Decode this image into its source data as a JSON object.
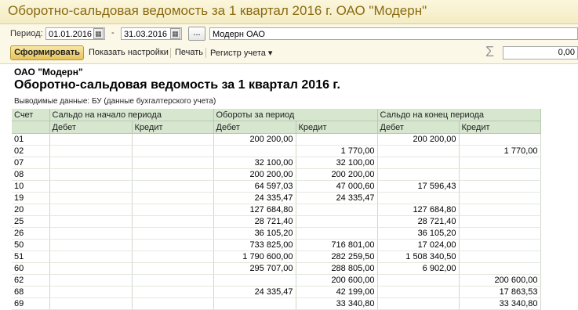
{
  "window": {
    "title": "Оборотно-сальдовая ведомость за 1 квартал 2016 г. ОАО \"Модерн\""
  },
  "period": {
    "label": "Период:",
    "from": "01.01.2016",
    "separator": "-",
    "to": "31.03.2016",
    "dots": "...",
    "organization": "Модерн ОАО"
  },
  "toolbar": {
    "generate": "Сформировать",
    "show_settings": "Показать настройки",
    "print": "Печать",
    "register": "Регистр учета ▾",
    "sigma": "Σ",
    "sum": "0,00"
  },
  "report": {
    "organization": "ОАО \"Модерн\"",
    "title": "Оборотно-сальдовая ведомость за 1 квартал 2016 г.",
    "subtitle": "Выводимые данные:  БУ (данные бухгалтерского учета)",
    "headers": {
      "account": "Счет",
      "opening": "Сальдо на начало периода",
      "turnover": "Обороты за период",
      "closing": "Сальдо на конец периода",
      "debit": "Дебет",
      "credit": "Кредит"
    },
    "rows": [
      [
        "01",
        "",
        "",
        "200 200,00",
        "",
        "200 200,00",
        ""
      ],
      [
        "02",
        "",
        "",
        "",
        "1 770,00",
        "",
        "1 770,00"
      ],
      [
        "07",
        "",
        "",
        "32 100,00",
        "32 100,00",
        "",
        ""
      ],
      [
        "08",
        "",
        "",
        "200 200,00",
        "200 200,00",
        "",
        ""
      ],
      [
        "10",
        "",
        "",
        "64 597,03",
        "47 000,60",
        "17 596,43",
        ""
      ],
      [
        "19",
        "",
        "",
        "24 335,47",
        "24 335,47",
        "",
        ""
      ],
      [
        "20",
        "",
        "",
        "127 684,80",
        "",
        "127 684,80",
        ""
      ],
      [
        "25",
        "",
        "",
        "28 721,40",
        "",
        "28 721,40",
        ""
      ],
      [
        "26",
        "",
        "",
        "36 105,20",
        "",
        "36 105,20",
        ""
      ],
      [
        "50",
        "",
        "",
        "733 825,00",
        "716 801,00",
        "17 024,00",
        ""
      ],
      [
        "51",
        "",
        "",
        "1 790 600,00",
        "282 259,50",
        "1 508 340,50",
        ""
      ],
      [
        "60",
        "",
        "",
        "295 707,00",
        "288 805,00",
        "6 902,00",
        ""
      ],
      [
        "62",
        "",
        "",
        "",
        "200 600,00",
        "",
        "200 600,00"
      ],
      [
        "68",
        "",
        "",
        "24 335,47",
        "42 199,00",
        "",
        "17 863,53"
      ],
      [
        "69",
        "",
        "",
        "",
        "33 340,80",
        "",
        "33 340,80"
      ]
    ]
  }
}
